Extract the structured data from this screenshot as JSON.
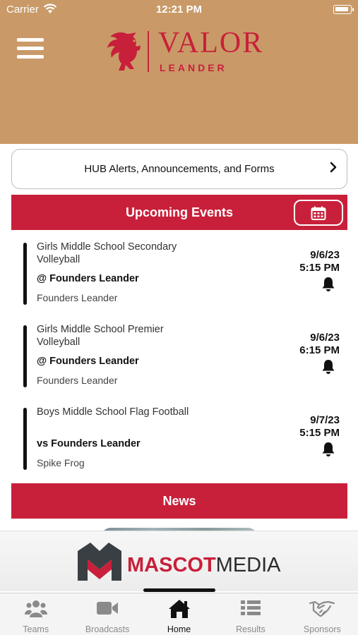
{
  "status_bar": {
    "carrier": "Carrier",
    "time": "12:21 PM"
  },
  "header": {
    "logo_title": "VALOR",
    "logo_subtitle": "LEANDER",
    "background_color": "#c99a68",
    "brand_color": "#c8203a"
  },
  "alerts": {
    "label": "HUB Alerts, Announcements, and Forms",
    "chevron": "›"
  },
  "upcoming_events": {
    "title": "Upcoming Events",
    "items": [
      {
        "name": "Girls Middle School Secondary Volleyball",
        "opponent": "@ Founders Leander",
        "location": "Founders Leander",
        "date": "9/6/23",
        "time": "5:15 PM"
      },
      {
        "name": "Girls Middle School Premier Volleyball",
        "opponent": "@ Founders Leander",
        "location": "Founders Leander",
        "date": "9/6/23",
        "time": "6:15 PM"
      },
      {
        "name": "Boys Middle School Flag Football",
        "opponent": "vs Founders Leander",
        "location": "Spike Frog",
        "date": "9/7/23",
        "time": "5:15 PM"
      }
    ]
  },
  "news": {
    "title": "News"
  },
  "sponsor": {
    "name_part1": "MASCOT",
    "name_part2": "MEDIA"
  },
  "tabbar": {
    "tabs": [
      {
        "label": "Teams",
        "icon": "team-icon"
      },
      {
        "label": "Broadcasts",
        "icon": "video-camera-icon"
      },
      {
        "label": "Home",
        "icon": "home-icon"
      },
      {
        "label": "Results",
        "icon": "list-icon"
      },
      {
        "label": "Sponsors",
        "icon": "handshake-icon"
      }
    ],
    "active": "Home"
  }
}
